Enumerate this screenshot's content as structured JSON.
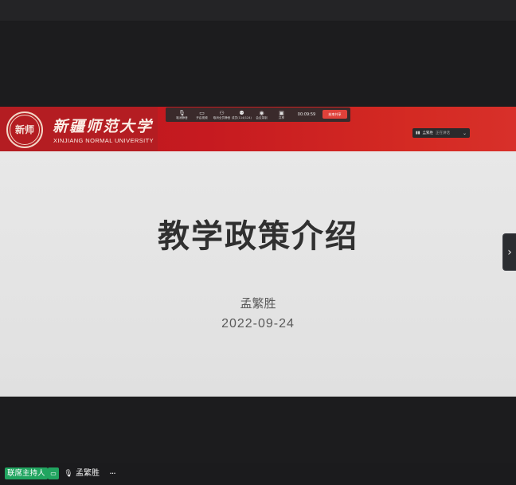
{
  "slide": {
    "title": "教学政策介绍",
    "presenter": "孟繁胜",
    "date": "2022-09-24"
  },
  "banner": {
    "school_cn": "新疆师范大学",
    "school_en": "XINJIANG NORMAL UNIVERSITY",
    "seal_text": "新师"
  },
  "meeting_toolbar": {
    "items": [
      {
        "label": "取消静音",
        "icon": "mic-icon"
      },
      {
        "label": "开启视频",
        "icon": "video-icon"
      },
      {
        "label": "取消全员静音",
        "icon": "mute-all-icon"
      },
      {
        "label": "成员(114/124)",
        "icon": "members-icon"
      },
      {
        "label": "会议录制",
        "icon": "record-icon"
      },
      {
        "label": "共享",
        "icon": "share-icon"
      }
    ],
    "timer": "00:09:59",
    "end_label": "结束共享"
  },
  "speaker_indicator": {
    "name": "孟繁胜",
    "status": "正在讲话"
  },
  "bottom_bar": {
    "role_badge": "联席主持人",
    "user_name": "孟繁胜",
    "more": "···"
  },
  "nav": {
    "next_arrow": "›"
  },
  "colors": {
    "banner_red": "#c61a20",
    "cohost_green": "#21a560",
    "end_button": "#e0413a"
  }
}
